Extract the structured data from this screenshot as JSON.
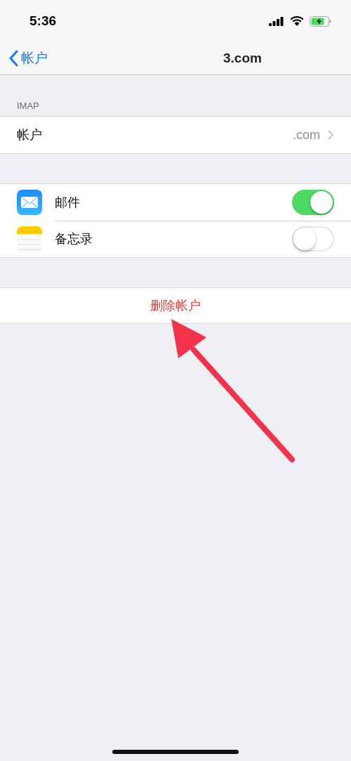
{
  "status_bar": {
    "time": "5:36"
  },
  "nav": {
    "back": "帐户",
    "title": "3.com"
  },
  "section_header": "IMAP",
  "account_row": {
    "label": "帐户",
    "value": ".com"
  },
  "apps": [
    {
      "kind": "mail",
      "label": "邮件",
      "on": true
    },
    {
      "kind": "notes",
      "label": "备忘录",
      "on": false
    }
  ],
  "delete_button": "删除帐户"
}
